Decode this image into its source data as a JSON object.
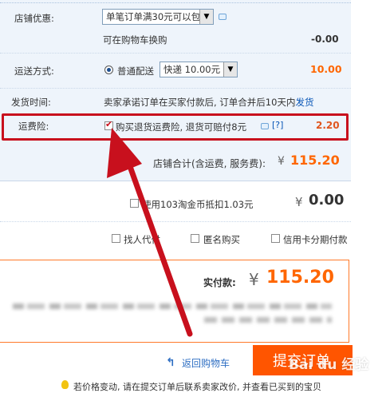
{
  "shop_discount": {
    "label": "店铺优惠:",
    "select_value": "单笔订单满30元可以包",
    "note": "可在购物车换购",
    "amount": "-0.00"
  },
  "shipping": {
    "label": "运送方式:",
    "option_label": "普通配送",
    "select_value": "快递 10.00元",
    "amount": "10.00"
  },
  "delivery_time": {
    "label": "发货时间:",
    "text": "卖家承诺订单在买家付款后, 订单合并后10天内",
    "link": "发货"
  },
  "insurance": {
    "label": "运费险:",
    "text": "购买退货运费险, 退货可赔付8元",
    "help": "[?]",
    "amount": "2.20"
  },
  "shop_total": {
    "label": "店铺合计(含运费, 服务费):",
    "currency": "¥",
    "amount": "115.20"
  },
  "taobao_coins": {
    "text": "使用103淘金币抵扣1.03元",
    "currency": "¥",
    "amount": "0.00"
  },
  "options": {
    "pay_for_me": "找人代付",
    "anonymous": "匿名购买",
    "credit_installment": "信用卡分期付款"
  },
  "payment": {
    "label": "实付款:",
    "currency": "¥",
    "amount": "115.20"
  },
  "actions": {
    "back_to_cart": "返回购物车",
    "submit": "提交订单"
  },
  "notice": "若价格变动, 请在提交订单后联系卖家改价, 并查看已买到的宝贝",
  "watermark": "Bai du 经验",
  "colors": {
    "accent_orange": "#ff6600",
    "annotation_red": "#c8101d",
    "panel_blue": "#eef4fb",
    "link_blue": "#0654b6"
  }
}
